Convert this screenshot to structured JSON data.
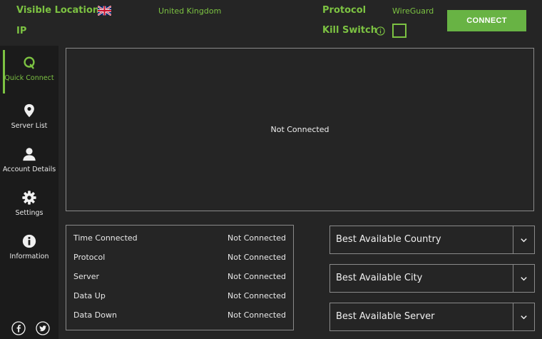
{
  "header": {
    "visible_location_label": "Visible Location",
    "visible_location_value": "United Kingdom",
    "ip_label": "IP",
    "protocol_label": "Protocol",
    "protocol_value": "WireGuard",
    "kill_switch_label": "Kill Switch",
    "kill_switch_checked": false,
    "connect_label": "CONNECT",
    "flag_icon": "uk-flag-icon"
  },
  "sidebar": {
    "items": [
      {
        "label": "Quick Connect",
        "icon": "quick-connect-icon",
        "active": true
      },
      {
        "label": "Server List",
        "icon": "location-pin-icon",
        "active": false
      },
      {
        "label": "Account Details",
        "icon": "user-icon",
        "active": false
      },
      {
        "label": "Settings",
        "icon": "gear-icon",
        "active": false
      },
      {
        "label": "Information",
        "icon": "info-icon",
        "active": false
      }
    ],
    "social": [
      "facebook-icon",
      "twitter-icon"
    ]
  },
  "main": {
    "status_text": "Not Connected"
  },
  "stats": [
    {
      "label": "Time Connected",
      "value": "Not Connected"
    },
    {
      "label": "Protocol",
      "value": "Not Connected"
    },
    {
      "label": "Server",
      "value": "Not Connected"
    },
    {
      "label": "Data Up",
      "value": "Not Connected"
    },
    {
      "label": "Data Down",
      "value": "Not Connected"
    }
  ],
  "selectors": {
    "country": "Best Available Country",
    "city": "Best Available City",
    "server": "Best Available Server"
  },
  "colors": {
    "accent": "#7cc242",
    "connect_button": "#68b344",
    "background": "#252525",
    "sidebar": "#1b1b1b"
  }
}
